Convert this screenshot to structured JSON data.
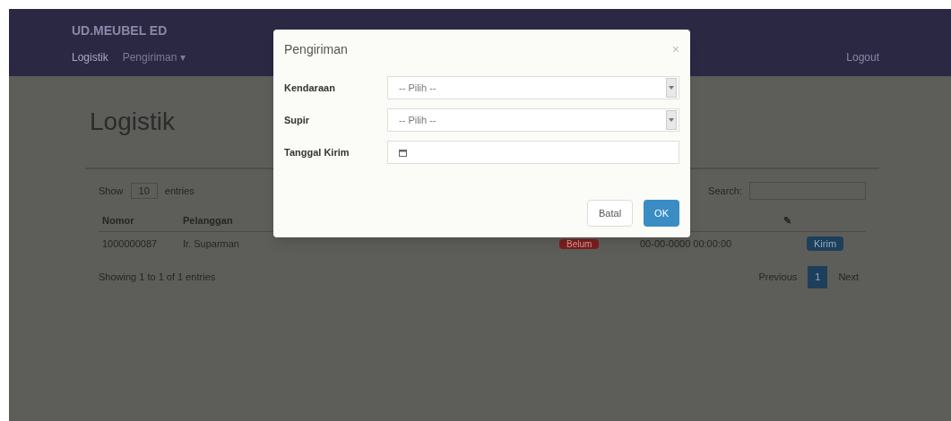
{
  "navbar": {
    "brand": "UD.MEUBEL ED",
    "links": [
      {
        "label": "Logistik",
        "selected": true
      },
      {
        "label": "Pengiriman ▾",
        "selected": false
      }
    ],
    "logout": "Logout"
  },
  "page_title": "Logistik",
  "table_controls": {
    "show": "Show",
    "length": "10",
    "entries": "entries",
    "search_label": "Search:"
  },
  "table": {
    "columns": [
      "Nomor",
      "Pelanggan",
      "",
      "",
      "✎",
      ""
    ],
    "rows": [
      {
        "cells": [
          "1000000087",
          "Ir. Suparman"
        ],
        "status": "Belum",
        "date": "00-00-0000 00:00:00",
        "action": "Kirim"
      }
    ]
  },
  "info": "Showing 1 to 1 of 1 entries",
  "pagination": [
    {
      "label": "Previous",
      "selected": false
    },
    {
      "label": "1",
      "selected": true
    },
    {
      "label": "Next",
      "selected": false
    }
  ],
  "modal": {
    "title": "Pengiriman",
    "close": "×",
    "fields": [
      {
        "label": "Kendaraan",
        "kind": "select",
        "value": "-- Pilih --"
      },
      {
        "label": "Supir",
        "kind": "select",
        "value": "-- Pilih --"
      },
      {
        "label": "Tanggal Kirim",
        "kind": "date"
      }
    ],
    "buttons": [
      "Batal",
      "OK"
    ]
  }
}
